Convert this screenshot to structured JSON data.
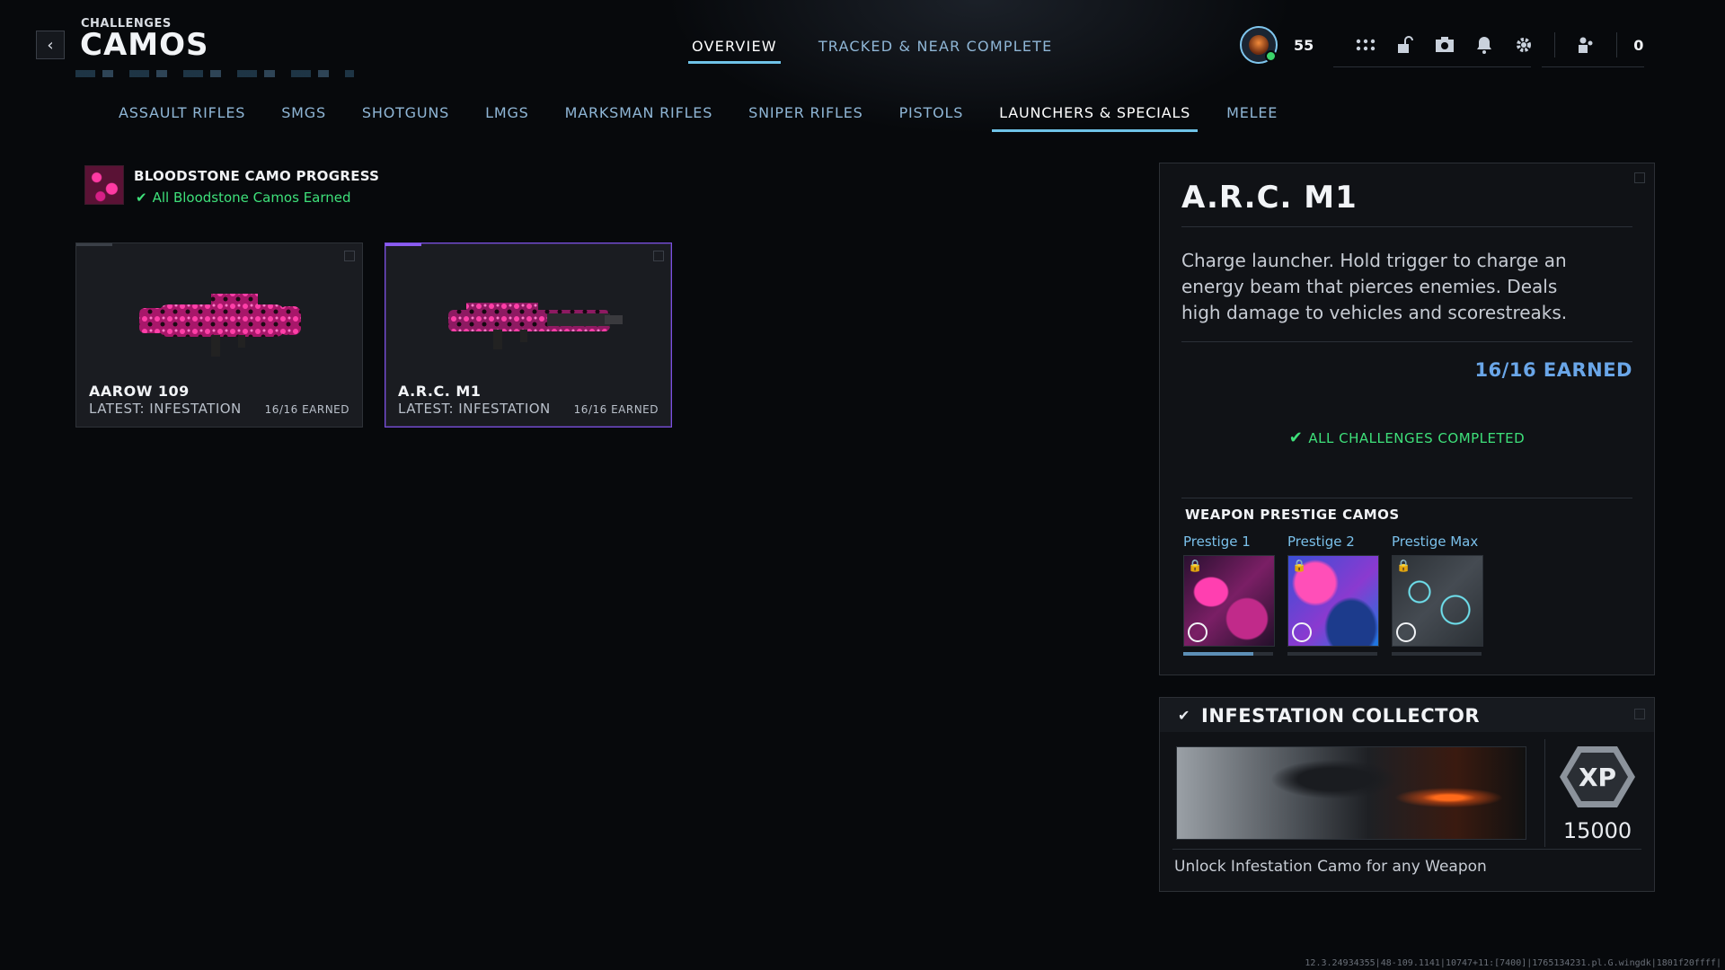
{
  "header": {
    "breadcrumb": "CHALLENGES",
    "title": "CAMOS",
    "back_icon": "chevron-left-icon"
  },
  "top_tabs": [
    {
      "label": "OVERVIEW",
      "active": true
    },
    {
      "label": "TRACKED & NEAR COMPLETE",
      "active": false
    }
  ],
  "hud": {
    "level": "55",
    "currency": "0",
    "icons": [
      "grid-menu-icon",
      "unlock-icon",
      "camera-icon",
      "bell-icon",
      "gear-icon",
      "social-icon"
    ]
  },
  "category_tabs": [
    {
      "label": "ASSAULT RIFLES",
      "active": false
    },
    {
      "label": "SMGS",
      "active": false
    },
    {
      "label": "SHOTGUNS",
      "active": false
    },
    {
      "label": "LMGS",
      "active": false
    },
    {
      "label": "MARKSMAN RIFLES",
      "active": false
    },
    {
      "label": "SNIPER RIFLES",
      "active": false
    },
    {
      "label": "PISTOLS",
      "active": false
    },
    {
      "label": "LAUNCHERS & SPECIALS",
      "active": true
    },
    {
      "label": "MELEE",
      "active": false
    }
  ],
  "camo_progress": {
    "title": "BLOODSTONE CAMO PROGRESS",
    "status": "All Bloodstone Camos Earned"
  },
  "weapons": [
    {
      "name": "AAROW 109",
      "latest": "LATEST: INFESTATION",
      "earned": "16/16 EARNED",
      "selected": false
    },
    {
      "name": "A.R.C. M1",
      "latest": "LATEST: INFESTATION",
      "earned": "16/16 EARNED",
      "selected": true
    }
  ],
  "detail": {
    "title": "A.R.C. M1",
    "description": "Charge launcher. Hold trigger to charge an energy beam that pierces enemies. Deals high damage to vehicles and scorestreaks.",
    "earned": "16/16 EARNED",
    "completed": "ALL CHALLENGES COMPLETED",
    "prestige_header": "WEAPON PRESTIGE CAMOS",
    "prestige": [
      {
        "label": "Prestige 1",
        "locked": true,
        "progress": 0.78
      },
      {
        "label": "Prestige 2",
        "locked": true,
        "progress": 0
      },
      {
        "label": "Prestige Max",
        "locked": true,
        "progress": 0
      }
    ]
  },
  "collector": {
    "title": "INFESTATION COLLECTOR",
    "xp_label": "XP",
    "xp_value": "15000",
    "description": "Unlock Infestation Camo for any Weapon"
  },
  "build_info": "12.3.24934355|48-109.1141|10747+11:[7400]|1765134231.pl.G.wingdk|1801f20ffff|",
  "colors": {
    "accent_blue": "#6fc3e8",
    "tab_text": "#8fb6d6",
    "success_green": "#3ee07a",
    "earned_blue": "#6aa6e8",
    "selected_purple": "#7b4fe0",
    "camo_pink": "#ff3aa3"
  }
}
